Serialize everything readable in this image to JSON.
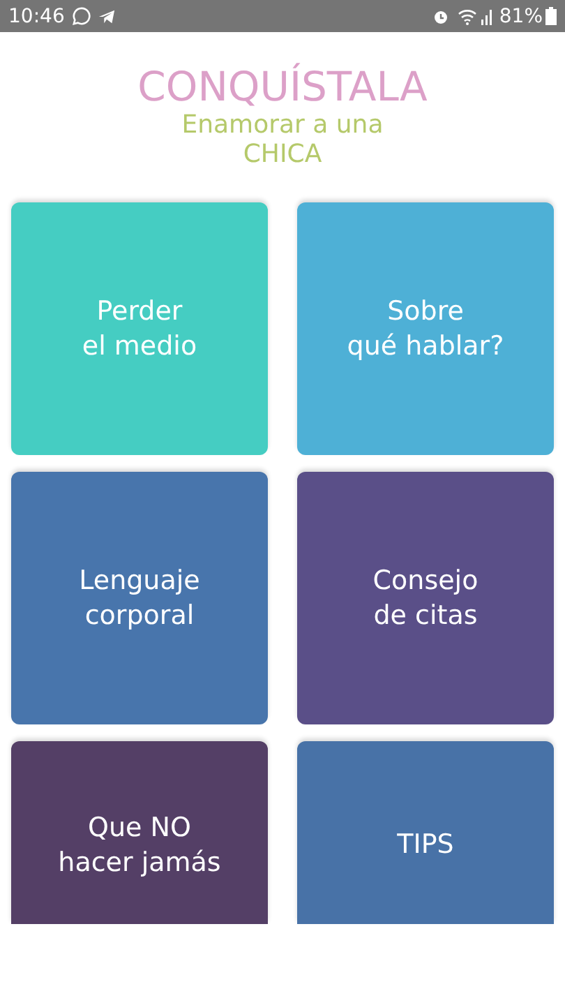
{
  "status_bar": {
    "time": "10:46",
    "battery": "81%"
  },
  "header": {
    "title": "CONQUÍSTALA",
    "subtitle": "Enamorar a una\nCHICA"
  },
  "tiles": [
    {
      "label": "Perder\nel medio",
      "color": "#45cdc2"
    },
    {
      "label": "Sobre\nqué hablar?",
      "color": "#4eb0d6"
    },
    {
      "label": "Lenguaje\ncorporal",
      "color": "#4875ac"
    },
    {
      "label": "Consejo\nde citas",
      "color": "#5a4f88"
    },
    {
      "label": "Que NO\nhacer jamás",
      "color": "#543f66"
    },
    {
      "label": "TIPS",
      "color": "#4872a7"
    }
  ]
}
